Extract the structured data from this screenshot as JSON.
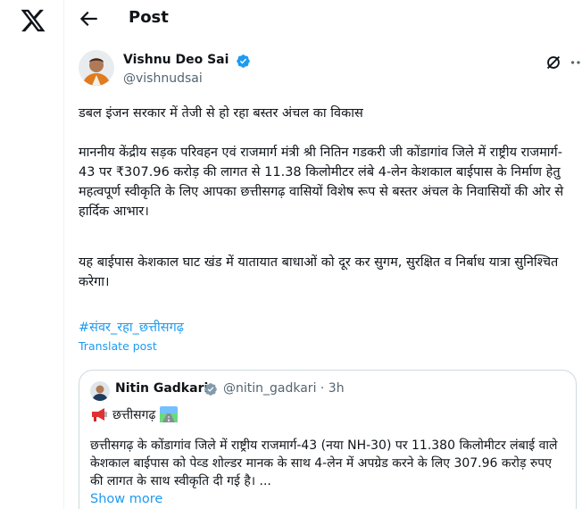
{
  "nav": {
    "logo_icon": "x-logo-icon"
  },
  "header": {
    "back_icon": "arrow-left-icon",
    "title": "Post"
  },
  "post": {
    "author_name": "Vishnu Deo Sai",
    "author_handle": "@vishnudsai",
    "verified_icon": "verified-badge-icon",
    "grok_icon": "grok-icon",
    "more_icon": "more-options-icon",
    "paragraph1": "डबल इंजन सरकार में तेजी से हो रहा बस्तर अंचल का विकास",
    "paragraph2": "माननीय केंद्रीय सड़क परिवहन एवं राजमार्ग मंत्री श्री नितिन गडकरी जी कोंडागांव जिले में राष्ट्रीय राजमार्ग- 43 पर ₹307.96 करोड़ की लागत से 11.38 किलोमीटर लंबे 4-लेन केशकाल बाईपास के निर्माण हेतु महत्वपूर्ण स्वीकृति के लिए आपका छत्तीसगढ़ वासियों विशेष रूप से बस्तर अंचल के निवासियों की ओर से हार्दिक आभार।",
    "paragraph3": "यह बाईपास केशकाल घाट खंड में यातायात बाधाओं को दूर कर सुगम, सुरक्षित व निर्बाध यात्रा सुनिश्चित करेगा।",
    "hashtag": "#संवर_रहा_छत्तीसगढ़",
    "translate_label": "Translate post"
  },
  "quote": {
    "author_name": "Nitin Gadkari",
    "author_handle": "@nitin_gadkari · 3h",
    "line1_text": "छत्तीसगढ़",
    "line1_icons": [
      "megaphone-emoji-icon",
      "road-emoji-icon"
    ],
    "body": "छत्तीसगढ़ के कोंडागांव जिले में राष्ट्रीय राजमार्ग-43 (नया NH-30) पर 11.380 किलोमीटर लंबाई वाले केशकाल बाईपास को पेव्ड शोल्डर मानक के साथ 4-लेन में अपग्रेड करने के लिए 307.96 करोड़ रुपए की लागत के साथ स्वीकृति दी गई है। ...",
    "show_more": "Show more"
  },
  "colors": {
    "link": "#1d9bf0",
    "text": "#0f1419",
    "secondary": "#536471",
    "border": "#cfd9de"
  }
}
